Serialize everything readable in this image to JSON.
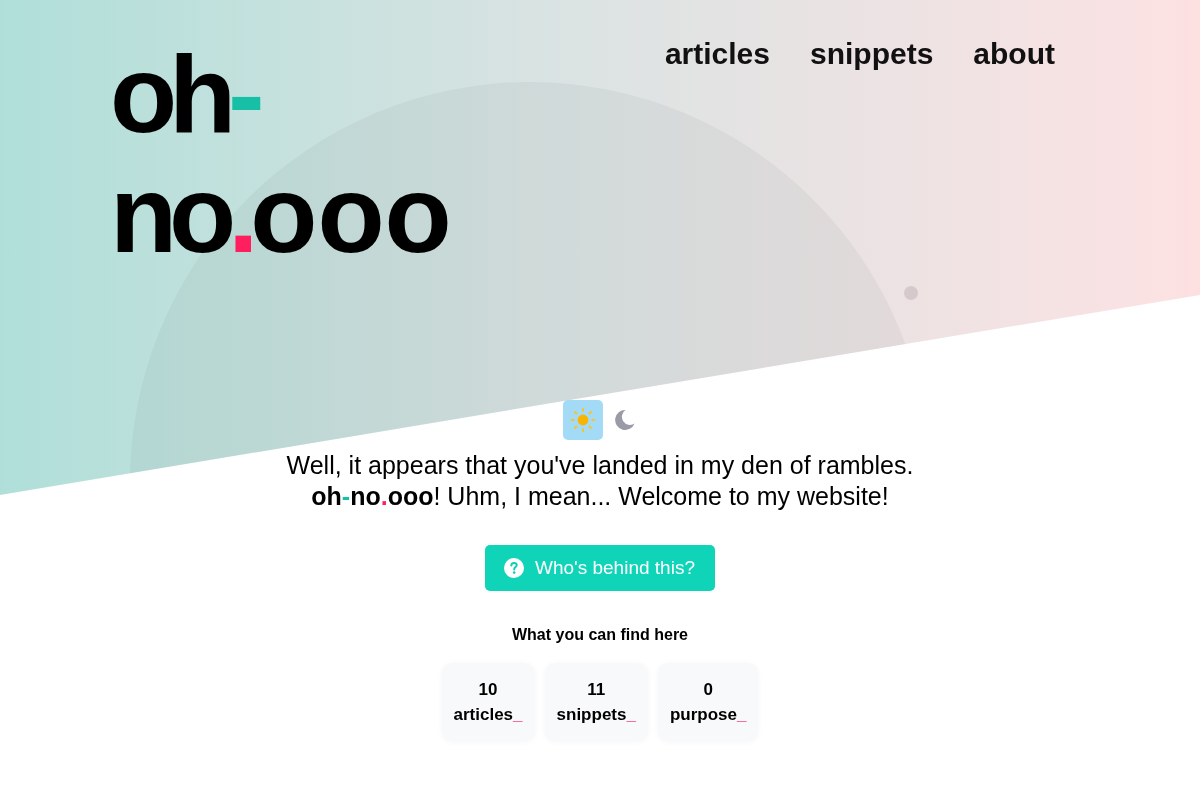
{
  "logo": {
    "lines": [
      [
        {
          "text": "oh",
          "color": "#000000"
        },
        {
          "text": "-",
          "color": "#17bfa7"
        }
      ],
      [
        {
          "text": "no",
          "color": "#000000"
        },
        {
          "text": ".",
          "color": "#ff1f5e"
        },
        {
          "text": "ooo",
          "color": "#000000"
        }
      ]
    ]
  },
  "nav": [
    "articles",
    "snippets",
    "about"
  ],
  "theme_toggle": [
    {
      "kind": "sun",
      "selected": true
    },
    {
      "kind": "moon",
      "selected": false
    }
  ],
  "intro": {
    "lines": [
      [
        {
          "text": "Well, it appears that you've landed in my den of rambles.",
          "bold": false,
          "color": "#000000"
        }
      ],
      [
        {
          "text": "oh",
          "bold": true,
          "color": "#000000"
        },
        {
          "text": "-",
          "bold": true,
          "color": "#17bfa7"
        },
        {
          "text": "no",
          "bold": true,
          "color": "#000000"
        },
        {
          "text": ".",
          "bold": true,
          "color": "#ff1f5e"
        },
        {
          "text": "ooo",
          "bold": true,
          "color": "#000000"
        },
        {
          "text": "! Uhm, I mean... Welcome to my website!",
          "bold": false,
          "color": "#000000"
        }
      ]
    ]
  },
  "cta_button": {
    "label": "Who's behind this?"
  },
  "stats": {
    "title": "What you can find here",
    "items": [
      {
        "count": "10",
        "label": "articles",
        "suffix": "_"
      },
      {
        "count": "11",
        "label": "snippets",
        "suffix": "_"
      },
      {
        "count": "0",
        "label": "purpose",
        "suffix": "_"
      }
    ]
  }
}
